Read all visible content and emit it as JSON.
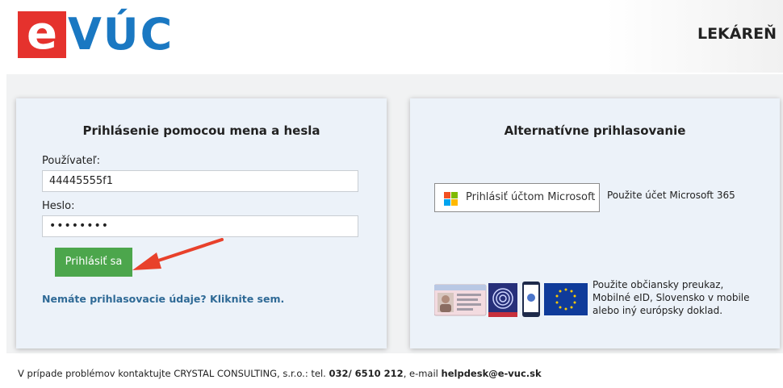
{
  "header": {
    "logo_letter": "e",
    "logo_text": "VÚC",
    "app_name": "LEKÁREŇ"
  },
  "login_card": {
    "title": "Prihlásenie pomocou mena a hesla",
    "username_label": "Používateľ:",
    "username_value": "44445555f1",
    "password_label": "Heslo:",
    "password_value": "••••••••",
    "submit_label": "Prihlásiť sa",
    "help_link": "Nemáte prihlasovacie údaje? Kliknite sem."
  },
  "alt_card": {
    "title": "Alternatívne prihlasovanie",
    "microsoft_button": "Prihlásiť účtom Microsoft",
    "microsoft_desc": "Použite účet Microsoft 365",
    "eid_desc": "Použite občiansky preukaz, Mobilné eID, Slovensko v mobile alebo iný európsky doklad."
  },
  "footer": {
    "text_before": "V prípade problémov kontaktujte CRYSTAL CONSULTING, s.r.o.: tel. ",
    "phone": "032/ 6510 212",
    "text_middle": ", e-mail ",
    "email": "helpdesk@e-vuc.sk"
  },
  "colors": {
    "brand_red": "#e5322d",
    "brand_blue": "#1a78c2",
    "button_green": "#4ca64c",
    "link_blue": "#2f6a96",
    "arrow_red": "#e8412b"
  },
  "icons": [
    "microsoft-logo-icon",
    "id-card-icon",
    "fingerprint-icon",
    "mobile-phone-icon",
    "eu-flag-icon",
    "annotation-arrow-icon"
  ]
}
